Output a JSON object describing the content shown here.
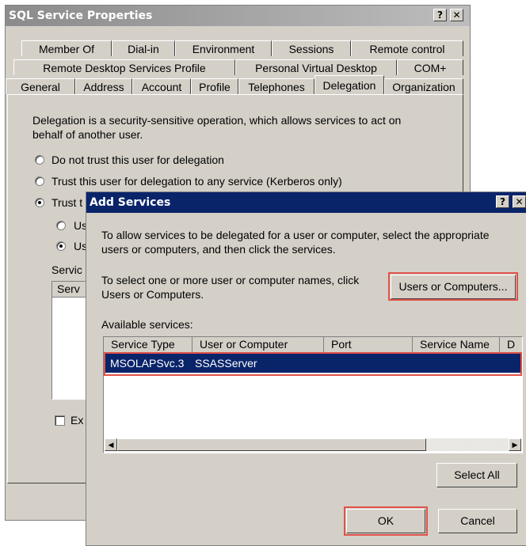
{
  "properties_window": {
    "title": "SQL Service Properties",
    "help_button": "?",
    "close_button": "✕",
    "tabs": {
      "row1": [
        "Member Of",
        "Dial-in",
        "Environment",
        "Sessions",
        "Remote control"
      ],
      "row2": [
        "Remote Desktop Services Profile",
        "Personal Virtual Desktop",
        "COM+"
      ],
      "row3": [
        "General",
        "Address",
        "Account",
        "Profile",
        "Telephones",
        "Delegation",
        "Organization"
      ],
      "selected": "Delegation"
    },
    "delegation": {
      "description": [
        "Delegation is a security-sensitive operation, which allows services to act on",
        "behalf of another user."
      ],
      "options": [
        "Do not trust this user for delegation",
        "Trust this user for delegation to any service (Kerberos only)",
        "Trust t"
      ],
      "selected_option": 2,
      "sub_options": [
        "Us",
        "Us"
      ],
      "selected_sub_option": 1,
      "services_label": "Servic",
      "services_column": "Serv",
      "expanded_label": "Ex"
    }
  },
  "add_services_dialog": {
    "title": "Add Services",
    "help_button": "?",
    "close_button": "✕",
    "intro": [
      "To allow services to be delegated for a user or computer, select the appropriate",
      "users or computers, and then click the services."
    ],
    "select_text": [
      "To select one or more user or computer names, click",
      "Users or Computers."
    ],
    "users_or_computers_button": "Users or Computers...",
    "available_services_label": "Available services:",
    "columns": [
      "Service Type",
      "User or Computer",
      "Port",
      "Service Name",
      "D"
    ],
    "rows": [
      {
        "service_type": "MSOLAPSvc.3",
        "user_or_computer": "SSASServer",
        "port": "",
        "service_name": ""
      }
    ],
    "scroll_left": "◀",
    "scroll_right": "▶",
    "select_all_button": "Select All",
    "ok_button": "OK",
    "cancel_button": "Cancel",
    "highlight_color": "#e0524a",
    "selection_color": "#0a246a"
  }
}
